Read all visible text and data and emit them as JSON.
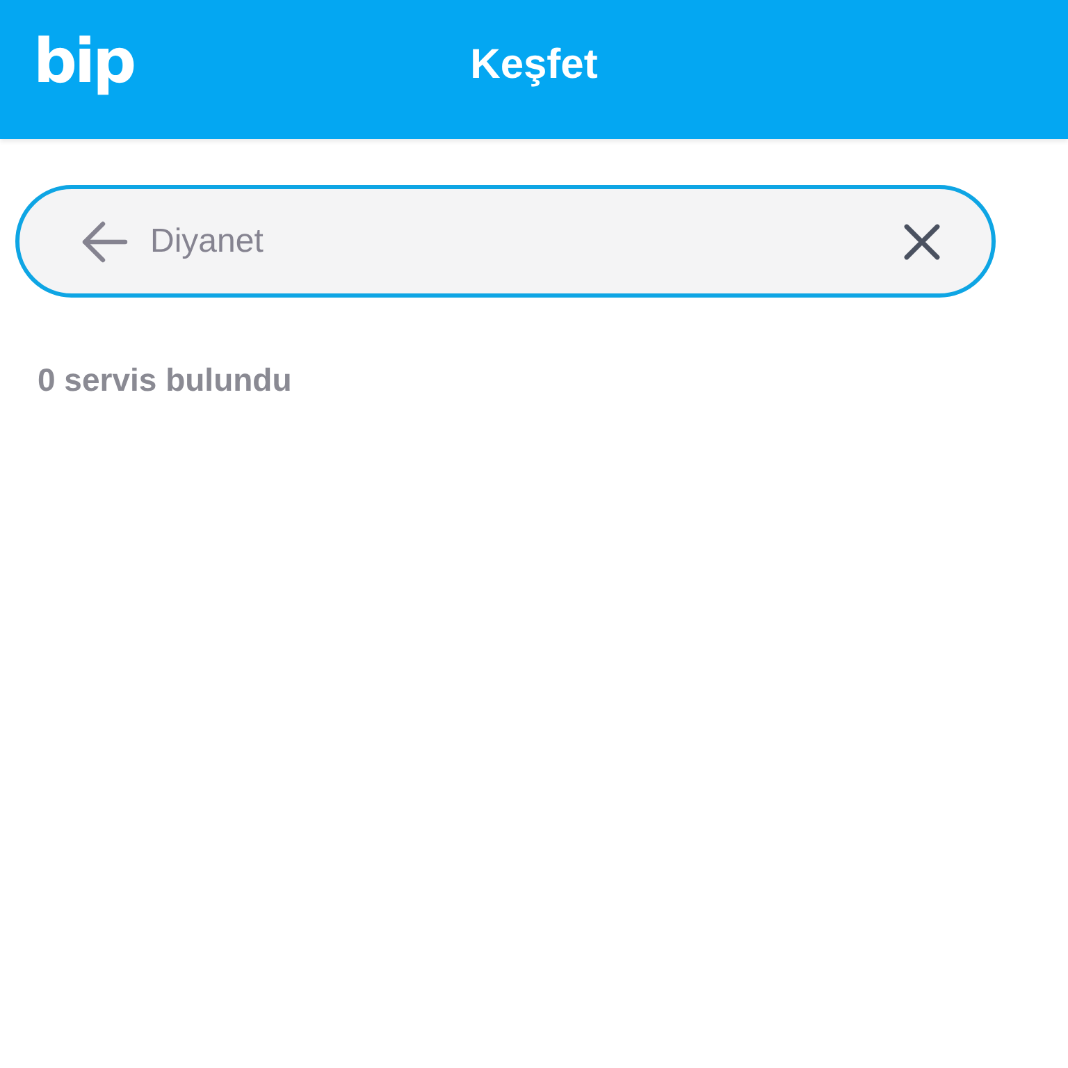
{
  "header": {
    "logo": "bip",
    "title": "Keşfet"
  },
  "search": {
    "value": "Diyanet"
  },
  "result_count": "0 servis bulundu"
}
